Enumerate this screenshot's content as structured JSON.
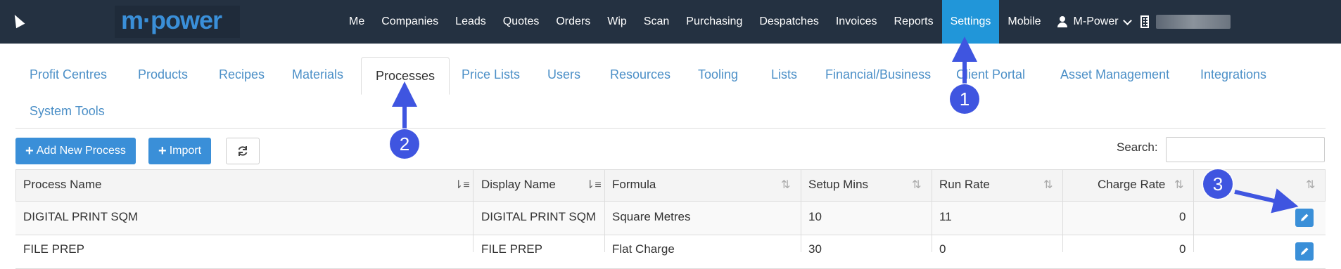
{
  "brand": {
    "logo_text": "m·power"
  },
  "nav": {
    "items": [
      "Me",
      "Companies",
      "Leads",
      "Quotes",
      "Orders",
      "Wip",
      "Scan",
      "Purchasing",
      "Despatches",
      "Invoices",
      "Reports",
      "Settings",
      "Mobile"
    ],
    "active": "Settings",
    "user_label": "M-Power"
  },
  "tabs": [
    "Profit Centres",
    "Products",
    "Recipes",
    "Materials",
    "Processes",
    "Price Lists",
    "Users",
    "Resources",
    "Tooling",
    "Lists",
    "Financial/Business",
    "Client Portal",
    "Asset Management",
    "Integrations",
    "System Tools"
  ],
  "active_tab": "Processes",
  "toolbar": {
    "add_label": "Add New Process",
    "import_label": "Import",
    "search_label": "Search:",
    "search_value": ""
  },
  "table": {
    "columns": [
      "Process Name",
      "Display Name",
      "Formula",
      "Setup Mins",
      "Run Rate",
      "Charge Rate",
      ""
    ],
    "rows": [
      [
        "DIGITAL PRINT SQM",
        "DIGITAL PRINT SQM",
        "Square Metres",
        "10",
        "11",
        "0"
      ],
      [
        "FILE PREP",
        "FILE PREP",
        "Flat Charge",
        "30",
        "0",
        "0"
      ]
    ]
  },
  "annotations": {
    "m1": "1",
    "m2": "2",
    "m3": "3"
  },
  "colors": {
    "nav_bg": "#243141",
    "accent": "#2196d9",
    "marker": "#3f55e0"
  }
}
